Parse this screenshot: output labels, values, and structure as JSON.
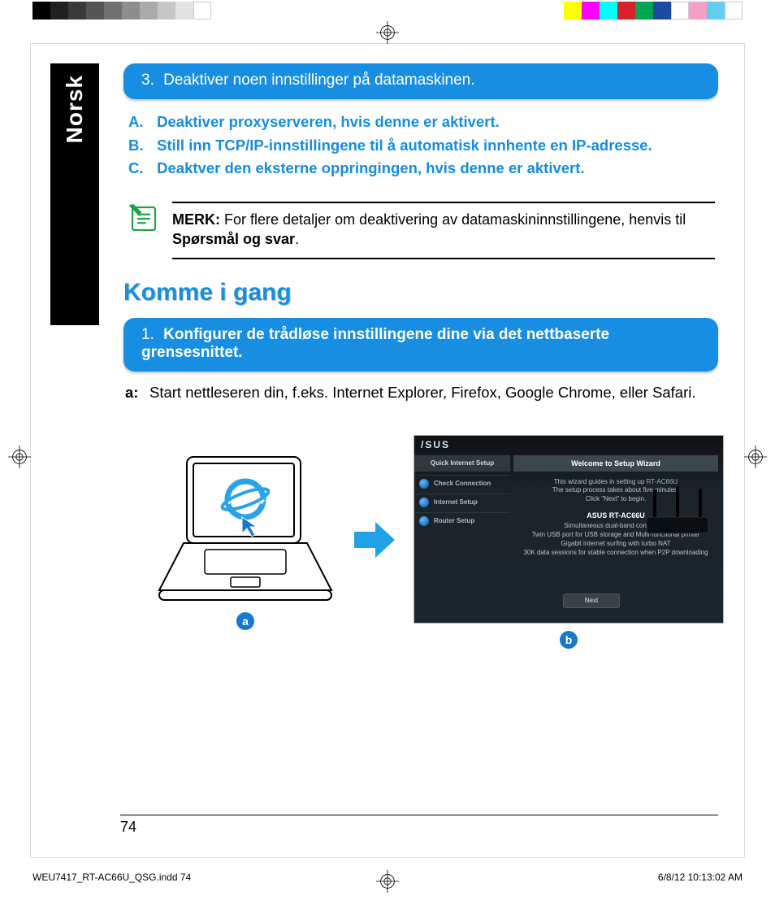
{
  "colorbar": {
    "left": [
      "#000000",
      "#202020",
      "#3a3a3a",
      "#555555",
      "#717171",
      "#8d8d8d",
      "#aaaaaa",
      "#c6c6c6",
      "#e2e2e2",
      "#ffffff"
    ],
    "right": [
      "#ffff00",
      "#ff00ff",
      "#00ffff",
      "#d7222b",
      "#00a651",
      "#1c4aa0",
      "#ffffff",
      "#f59fc5",
      "#63cdf1",
      "#ffffff"
    ]
  },
  "langTab": "Norsk",
  "step3": {
    "num": "3.",
    "text": "Deaktiver noen innstillinger på datamaskinen."
  },
  "sublist": [
    {
      "label": "A.",
      "text": "Deaktiver proxyserveren, hvis denne er aktivert."
    },
    {
      "label": "B.",
      "text": "Still inn TCP/IP-innstillingene til å automatisk innhente en IP-adresse."
    },
    {
      "label": "C.",
      "text": "Deaktver den eksterne oppringingen, hvis denne er aktivert."
    }
  ],
  "note": {
    "label": "MERK:",
    "text1": "For flere detaljer om deaktivering av datamaskininnstillingene, henvis til ",
    "bold": "Spørsmål og svar",
    "tail": "."
  },
  "sectionHead": "Komme i gang",
  "step1": {
    "num": "1.",
    "text": "Konfigurer de trådløse innstillingene dine via det nettbaserte grensesnittet."
  },
  "instrA": {
    "label": "a:",
    "text": "Start nettleseren din, f.eks. Internet  Explorer, Firefox, Google Chrome, eller Safari."
  },
  "badges": {
    "a": "a",
    "b": "b"
  },
  "wizard": {
    "brand": "/SUS",
    "sideHeader": "Quick Internet Setup",
    "sideItems": [
      "Check Connection",
      "Internet Setup",
      "Router Setup"
    ],
    "title": "Welcome to Setup Wizard",
    "intro1": "This wizard guides in setting up",
    "introModel": "RT-AC66U",
    "intro2": "The setup process takes about five minutes.",
    "intro3": "Click \"Next\" to begin.",
    "model": "ASUS RT-AC66U",
    "feat": [
      "Simultaneous  dual-band connection",
      "Twin USB port for USB storage and Multi-functional printer",
      "Gigabit internet surfing with turbo NAT",
      "30K data sessions for stable connection when P2P downloading"
    ],
    "next": "Next"
  },
  "pageNumber": "74",
  "docFooter": {
    "left": "WEU7417_RT-AC66U_QSG.indd   74",
    "right": "6/8/12   10:13:02 AM"
  }
}
